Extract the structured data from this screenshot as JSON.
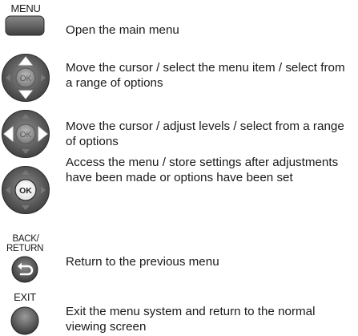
{
  "rows": [
    {
      "key_label": "MENU",
      "icon": "menu-button-icon",
      "text": "Open the main menu"
    },
    {
      "key_label": "OK",
      "icon": "cursor-updown-ok-icon",
      "text": "Move the cursor / select the menu item / select from a range of options"
    },
    {
      "key_label": "OK",
      "icon": "cursor-leftright-ok-icon",
      "text": "Move the cursor / adjust levels / select from a range of options"
    },
    {
      "key_label": "OK",
      "icon": "ok-center-icon",
      "text": "Access the menu / store settings after adjustments have been made or options have been set"
    },
    {
      "key_label_line1": "BACK/",
      "key_label_line2": "RETURN",
      "icon": "back-return-button-icon",
      "text": "Return to the previous menu"
    },
    {
      "key_label": "EXIT",
      "icon": "exit-button-icon",
      "text": "Exit the menu system and return to the normal viewing screen"
    }
  ]
}
